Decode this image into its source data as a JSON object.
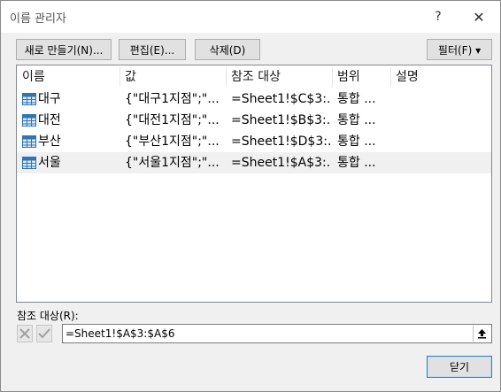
{
  "dialog": {
    "title": "이름 관리자",
    "help_label": "?",
    "close_label": "✕"
  },
  "toolbar": {
    "new_label": "새로 만들기(N)...",
    "edit_label": "편집(E)...",
    "delete_label": "삭제(D)",
    "filter_label": "필터(F) ▾"
  },
  "table": {
    "columns": [
      "이름",
      "값",
      "참조 대상",
      "범위",
      "설명"
    ],
    "rows": [
      {
        "name": "대구",
        "value": "{\"대구1지점\";\"...",
        "refers_to": "=Sheet1!$C$3:...",
        "scope": "통합 ...",
        "comment": ""
      },
      {
        "name": "대전",
        "value": "{\"대전1지점\";\"...",
        "refers_to": "=Sheet1!$B$3:...",
        "scope": "통합 ...",
        "comment": ""
      },
      {
        "name": "부산",
        "value": "{\"부산1지점\";\"...",
        "refers_to": "=Sheet1!$D$3:...",
        "scope": "통합 ...",
        "comment": ""
      },
      {
        "name": "서울",
        "value": "{\"서울1지점\";\"...",
        "refers_to": "=Sheet1!$A$3:...",
        "scope": "통합 ...",
        "comment": ""
      }
    ],
    "selected_row": 3
  },
  "refers_to": {
    "label": "참조 대상(R):",
    "value": "=Sheet1!$A$3:$A$6"
  },
  "footer": {
    "close_label": "닫기"
  },
  "colors": {
    "table_icon": "#2e75b6",
    "selected_row": "#f0f0f0",
    "default_button_border": "#3c7fb1"
  }
}
